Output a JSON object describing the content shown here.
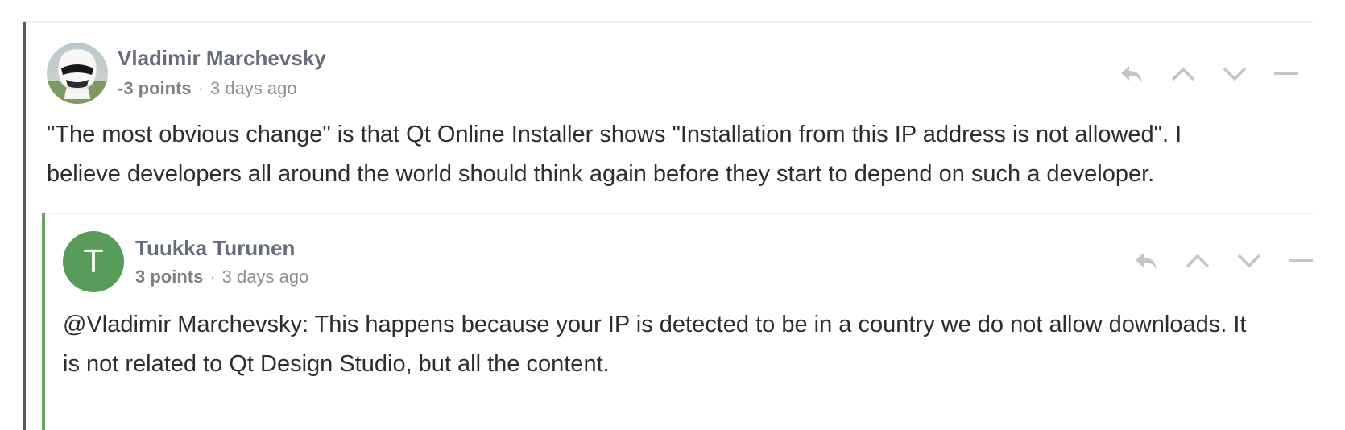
{
  "comments": [
    {
      "author": "Vladimir Marchevsky",
      "points": "-3 points",
      "separator": "·",
      "time": "3 days ago",
      "avatar_icon": "helmet-avatar",
      "text": "\"The most obvious change\" is that Qt Online Installer shows \"Installation from this IP address is not allowed\". I believe developers all around the world should think again before they start to depend on such a developer."
    },
    {
      "author": "Tuukka Turunen",
      "points": "3 points",
      "separator": "·",
      "time": "3 days ago",
      "avatar_letter": "T",
      "avatar_color": "#589a58",
      "text": "@Vladimir Marchevsky: This happens because your IP is detected to be in a country we do not allow downloads. It is not related to Qt Design Studio, but all the content."
    }
  ],
  "actions": {
    "reply_icon": "reply-icon",
    "upvote_icon": "chevron-up-icon",
    "downvote_icon": "chevron-down-icon",
    "collapse_icon": "minus-icon"
  },
  "colors": {
    "parent_thread_bar": "#555d5f",
    "reply_thread_bar": "#6aa568",
    "icon_gray": "#c2c6c8"
  }
}
